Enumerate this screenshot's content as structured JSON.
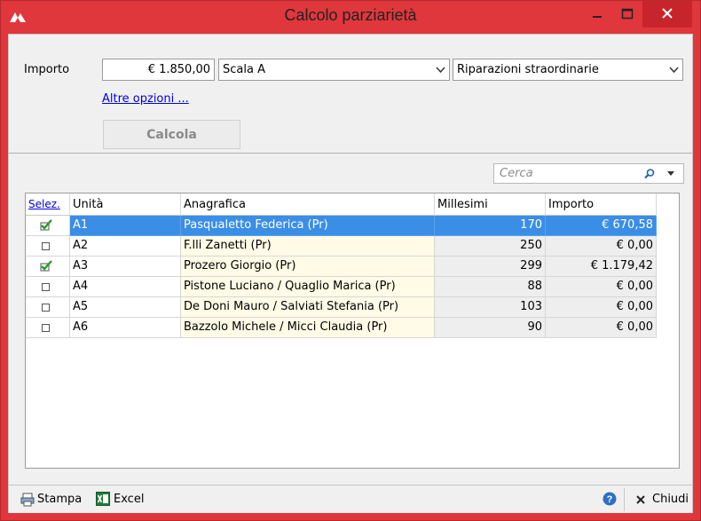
{
  "window": {
    "title": "Calcolo parziarietà",
    "app_icon": "logo-icon",
    "controls": [
      "minimize-icon",
      "maximize-icon",
      "close-icon"
    ]
  },
  "form": {
    "importo_label": "Importo",
    "importo_value": "€ 1.850,00",
    "scala_value": "Scala A",
    "tipo_value": "Riparazioni straordinarie",
    "altre_opzioni_label": "Altre opzioni ...",
    "calcola_label": "Calcola"
  },
  "search": {
    "placeholder": "Cerca",
    "icon": "search-icon"
  },
  "grid": {
    "headers": {
      "sel": "Selez.",
      "unit": "Unità",
      "anagrafica": "Anagrafica",
      "millesimi": "Millesimi",
      "importo": "Importo"
    },
    "rows": [
      {
        "checked": true,
        "unit": "A1",
        "anagrafica": "Pasqualetto Federica (Pr)",
        "millesimi": "170",
        "importo": "€ 670,58",
        "selected": true
      },
      {
        "checked": false,
        "unit": "A2",
        "anagrafica": "F.lli Zanetti (Pr)",
        "millesimi": "250",
        "importo": "€ 0,00",
        "selected": false
      },
      {
        "checked": true,
        "unit": "A3",
        "anagrafica": "Prozero Giorgio (Pr)",
        "millesimi": "299",
        "importo": "€ 1.179,42",
        "selected": false
      },
      {
        "checked": false,
        "unit": "A4",
        "anagrafica": "Pistone Luciano / Quaglio Marica (Pr)",
        "millesimi": "88",
        "importo": "€ 0,00",
        "selected": false
      },
      {
        "checked": false,
        "unit": "A5",
        "anagrafica": "De Doni Mauro / Salviati Stefania (Pr)",
        "millesimi": "103",
        "importo": "€ 0,00",
        "selected": false
      },
      {
        "checked": false,
        "unit": "A6",
        "anagrafica": "Bazzolo Michele / Micci Claudia (Pr)",
        "millesimi": "90",
        "importo": "€ 0,00",
        "selected": false
      }
    ]
  },
  "footer": {
    "stampa_label": "Stampa",
    "excel_label": "Excel",
    "chiudi_label": "Chiudi"
  },
  "colors": {
    "titlebar": "#e0373c",
    "selection": "#3a8ee6",
    "link": "#0000dd",
    "anagrafica_bg": "#fffbe6"
  }
}
